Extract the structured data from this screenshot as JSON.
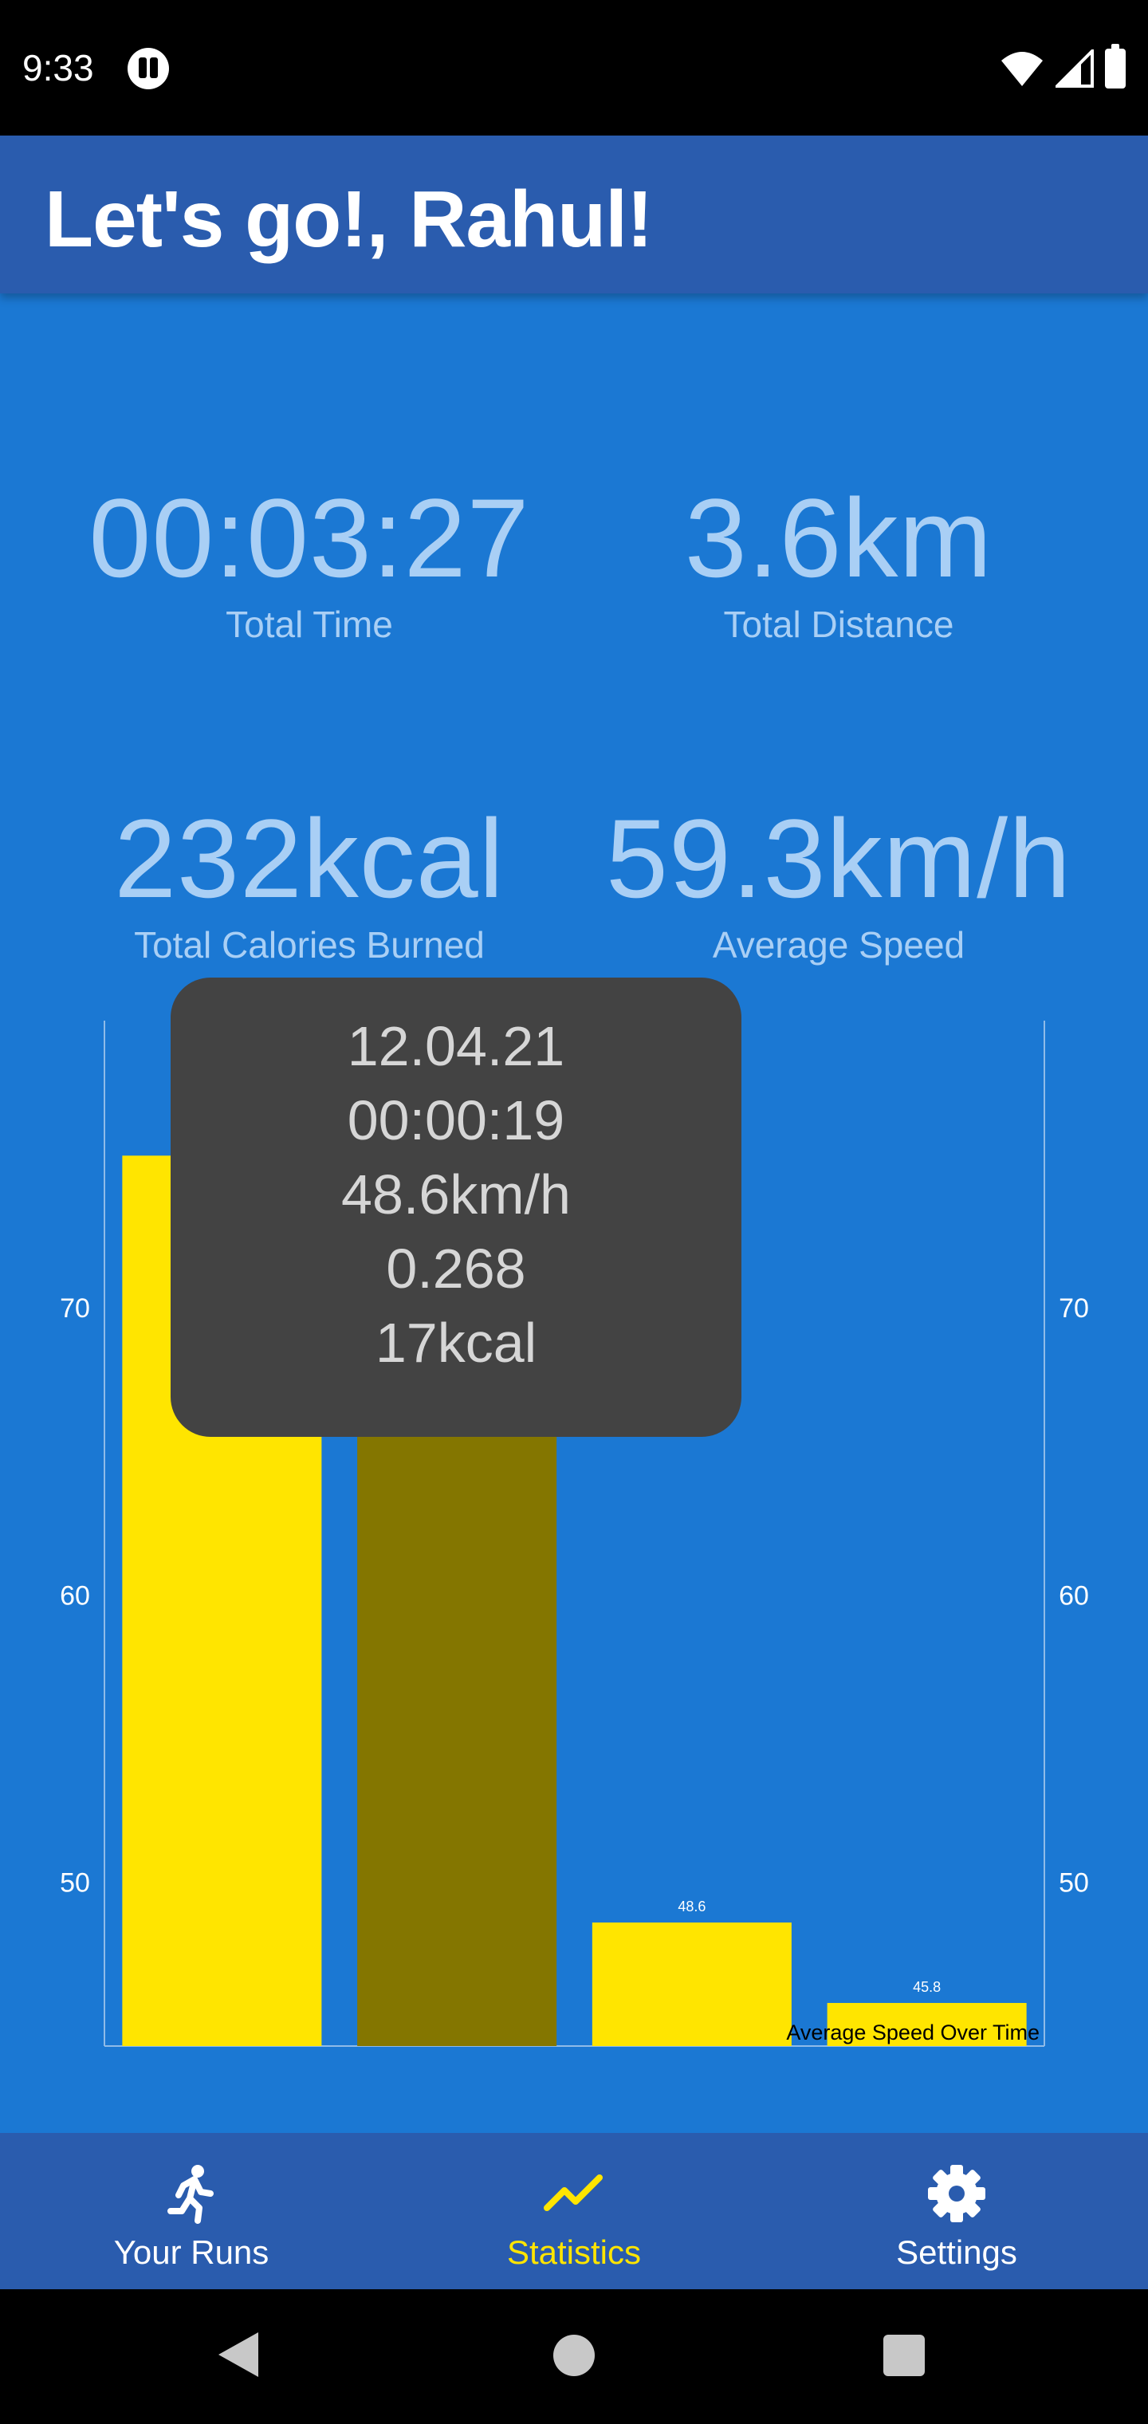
{
  "status_bar": {
    "time": "9:33"
  },
  "header": {
    "title": "Let's go!, Rahul!"
  },
  "stats": {
    "total_time": {
      "value": "00:03:27",
      "label": "Total Time"
    },
    "total_distance": {
      "value": "3.6km",
      "label": "Total Distance"
    },
    "total_calories": {
      "value": "232kcal",
      "label": "Total Calories Burned"
    },
    "average_speed": {
      "value": "59.3km/h",
      "label": "Average Speed"
    }
  },
  "chart_data": {
    "type": "bar",
    "description_label": "Average Speed Over Time",
    "ylim": [
      44.3,
      80
    ],
    "y_ticks": [
      50,
      60,
      70
    ],
    "values": [
      75.3,
      67.5,
      48.6,
      45.8
    ],
    "value_labels": [
      "",
      "",
      "48.6",
      "45.8"
    ],
    "highlighted_index": 1,
    "colors": {
      "bar": "#ffe500",
      "highlight": "#847600",
      "axis": "#8fbbe8",
      "tick_label": "#ffffff"
    }
  },
  "tooltip": {
    "date": "12.04.21",
    "duration": "00:00:19",
    "speed": "48.6km/h",
    "distance": "0.268",
    "calories": "17kcal"
  },
  "bottom_nav": {
    "items": [
      {
        "label": "Your Runs",
        "icon": "runner-icon",
        "active": false
      },
      {
        "label": "Statistics",
        "icon": "trending-up-icon",
        "active": true
      },
      {
        "label": "Settings",
        "icon": "gear-icon",
        "active": false
      }
    ]
  },
  "colors": {
    "background": "#1b78d3",
    "app_bar": "#2a5cae",
    "accent": "#ffe500",
    "stat_text": "#a9cff5"
  }
}
